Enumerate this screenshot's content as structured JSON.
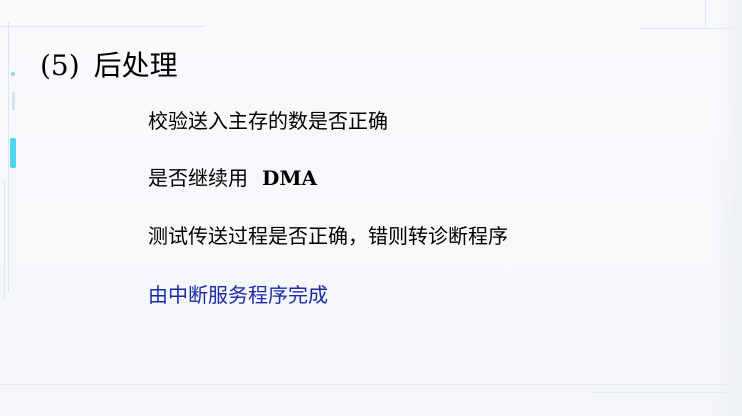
{
  "heading": {
    "number": "(5)",
    "title": "后处理"
  },
  "bullets": [
    {
      "text": "校验送入主存的数是否正确"
    },
    {
      "text": "是否继续用",
      "suffix": "DMA"
    },
    {
      "text": "测试传送过程是否正确，错则转诊断程序"
    },
    {
      "text": "由中断服务程序完成",
      "color": "#1a2aa8"
    }
  ],
  "colors": {
    "accent": "#4fd6ee",
    "highlight_text": "#1a2aa8"
  }
}
